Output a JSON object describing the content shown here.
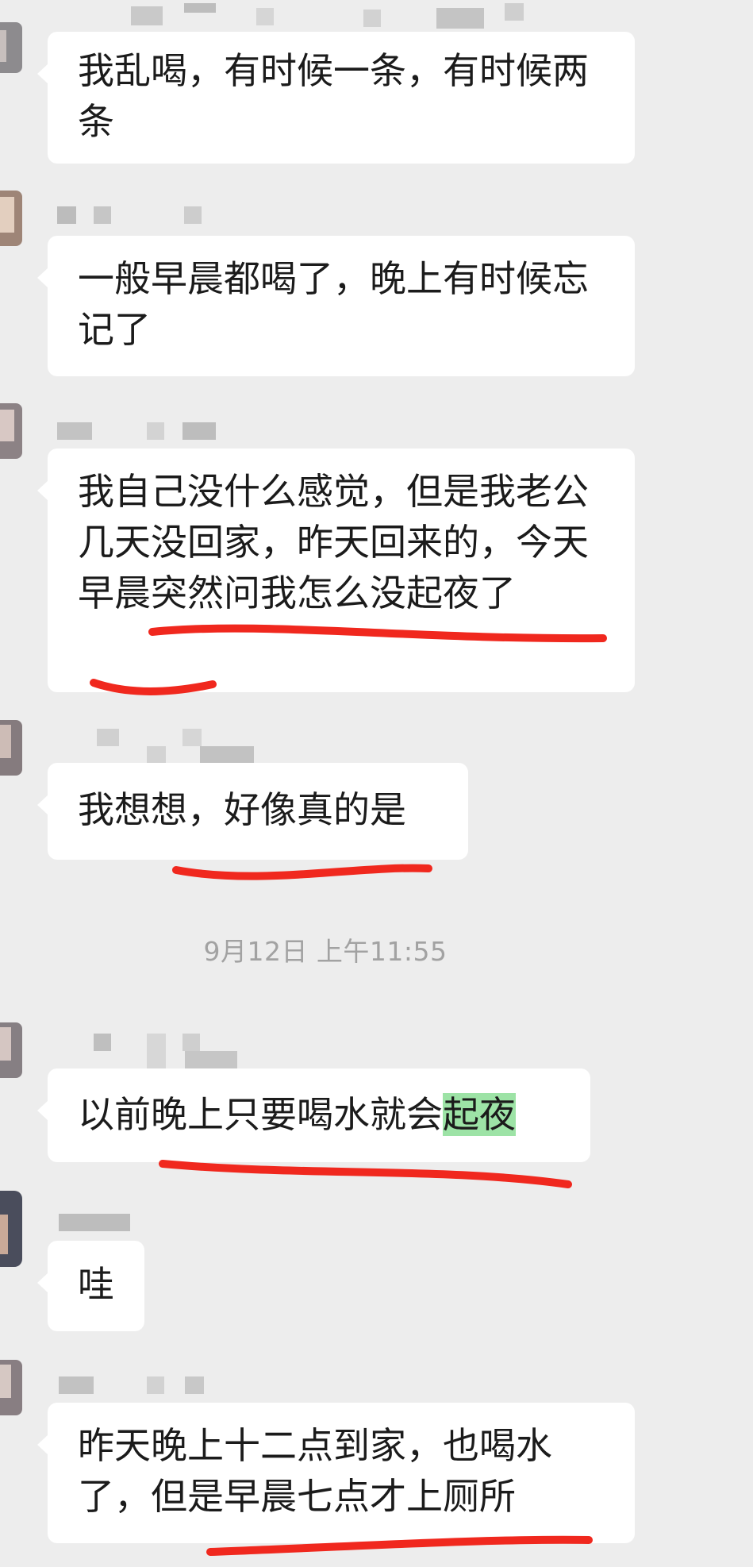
{
  "chat": {
    "messages": [
      {
        "text": "我乱喝，有时候一条，有时候两条"
      },
      {
        "text": "一般早晨都喝了，晚上有时候忘记了"
      },
      {
        "text": "我自己没什么感觉，但是我老公几天没回家，昨天回来的，今天早晨突然问我怎么没起夜了"
      },
      {
        "text": "我想想，好像真的是"
      },
      {
        "text_before": "以前晚上只要喝水就会",
        "text_highlight": "起夜"
      },
      {
        "text": "哇"
      },
      {
        "text": "昨天晚上十二点到家，也喝水了，但是早晨七点才上厕所"
      }
    ],
    "timestamp": "9月12日 上午11:55"
  },
  "colors": {
    "background": "#ededed",
    "bubble": "#ffffff",
    "highlight": "#9de3a6",
    "annotation_red": "#f0281e",
    "timestamp": "#a2a2a2"
  }
}
